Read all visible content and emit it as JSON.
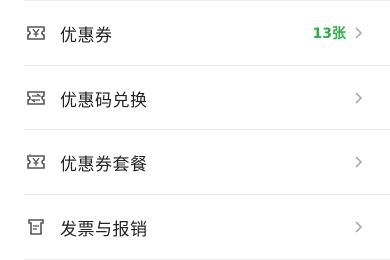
{
  "menu": {
    "items": [
      {
        "icon": "coupon-ticket-icon",
        "label": "优惠券",
        "badge": "13张"
      },
      {
        "icon": "coupon-redeem-icon",
        "label": "优惠码兑换"
      },
      {
        "icon": "coupon-bundle-icon",
        "label": "优惠券套餐"
      },
      {
        "icon": "invoice-receipt-icon",
        "label": "发票与报销"
      }
    ]
  },
  "colors": {
    "badge": "#2fae47",
    "label": "#222222",
    "icon": "#555555",
    "chevron": "#b0b0b0",
    "divider": "#ececec"
  }
}
